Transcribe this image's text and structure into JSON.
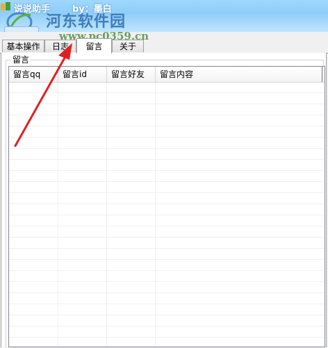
{
  "window": {
    "title": "说说助手",
    "author": "by：墨白",
    "watermark_name": "河东软件园",
    "watermark_url": "www.pc0359.cn"
  },
  "tabs": [
    {
      "label": "基本操作",
      "active": false
    },
    {
      "label": "日志",
      "active": false
    },
    {
      "label": "留言",
      "active": true
    },
    {
      "label": "关于",
      "active": false
    }
  ],
  "group": {
    "label": "留言"
  },
  "table": {
    "columns": [
      "留言qq",
      "留言id",
      "留言好友",
      "留言内容"
    ],
    "rows": []
  },
  "colors": {
    "titlebar": "#9fd7ff",
    "arrow": "#e02020",
    "watermark": "#2f6fb0"
  }
}
